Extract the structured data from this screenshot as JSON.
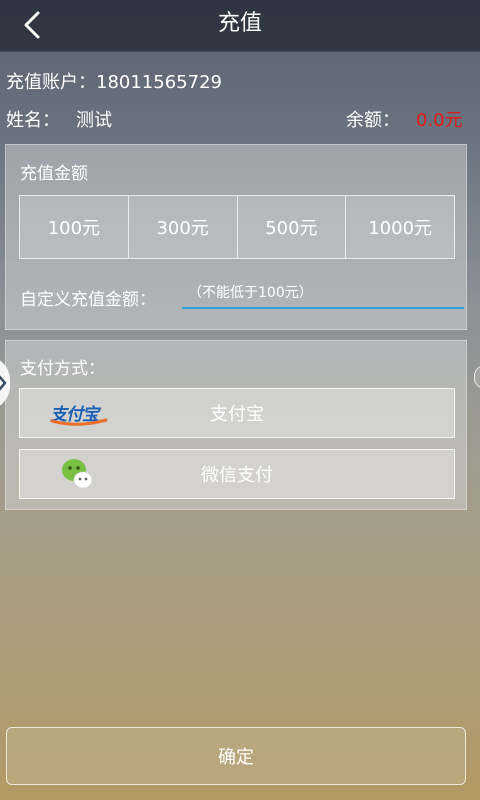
{
  "header": {
    "title": "充值",
    "back_icon": "chevron-left-icon"
  },
  "account": {
    "label": "充值账户：",
    "number": "18011565729"
  },
  "user": {
    "name_label": "姓名：",
    "name": "测试",
    "balance_label": "余额：",
    "balance": "0.0元",
    "balance_color": "#e01b1b"
  },
  "amount_panel": {
    "label": "充值金额",
    "options": [
      "100元",
      "300元",
      "500元",
      "1000元"
    ],
    "custom_label": "自定义充值金额：",
    "custom_placeholder": "（不能低于100元）",
    "input_accent": "#2ea0df"
  },
  "payment_panel": {
    "label": "支付方式：",
    "methods": [
      {
        "label": "支付宝",
        "logo_text": "支付宝",
        "icon": "alipay-logo-icon"
      },
      {
        "label": "微信支付",
        "icon": "wechat-logo-icon"
      }
    ]
  },
  "footer": {
    "confirm_label": "确定"
  }
}
